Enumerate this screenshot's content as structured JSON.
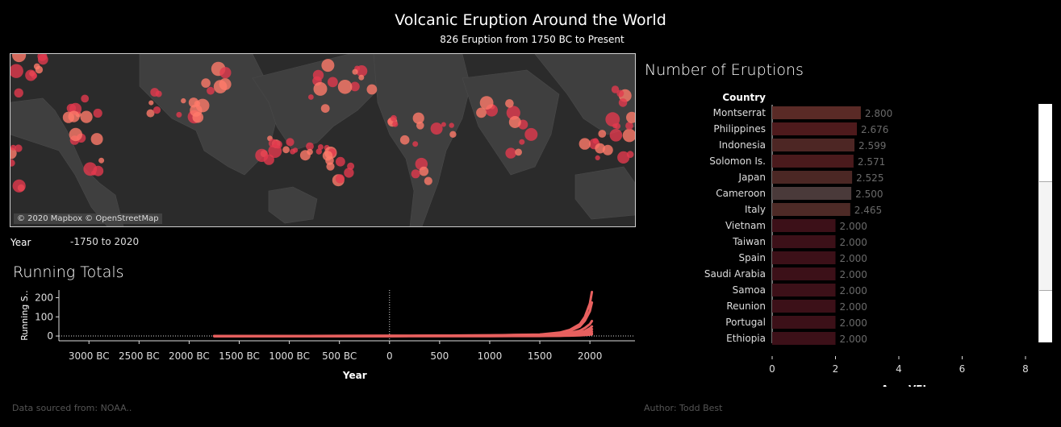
{
  "header": {
    "title": "Volcanic Eruption Around the World",
    "subtitle": "826 Eruption from 1750 BC to Present"
  },
  "map": {
    "credit": "© 2020 Mapbox © OpenStreetMap",
    "colors": {
      "water": "#2b2b2b",
      "land": "#3f3f3f",
      "dot": "#ff6b6b"
    }
  },
  "filter": {
    "label": "Year",
    "value": "-1750 to 2020"
  },
  "running_totals": {
    "title": "Running Totals"
  },
  "bar_section": {
    "title": "Number of Eruptions"
  },
  "footer": {
    "source": "Data sourced from: NOAA..",
    "author": "Author: Todd Best"
  },
  "chart_data": [
    {
      "type": "line",
      "title": "Running Totals",
      "xlabel": "Year",
      "ylabel": "Running S..",
      "x_ticks": [
        "3000 BC",
        "2500 BC",
        "2000 BC",
        "1500 BC",
        "1000 BC",
        "500 BC",
        "0",
        "500",
        "1000",
        "1500",
        "2000"
      ],
      "x_tick_values": [
        -3000,
        -2500,
        -2000,
        -1500,
        -1000,
        -500,
        0,
        500,
        1000,
        1500,
        2000
      ],
      "y_ticks": [
        0,
        100,
        200
      ],
      "xlim": [
        -3300,
        2450
      ],
      "ylim": [
        -25,
        240
      ],
      "color": "#e8605f",
      "series": [
        {
          "x": [
            -1750,
            0,
            1000,
            1500,
            1700,
            1800,
            1900,
            1950,
            2000,
            2020
          ],
          "y": [
            0,
            1,
            3,
            8,
            18,
            32,
            62,
            100,
            170,
            230
          ]
        },
        {
          "x": [
            -1750,
            0,
            1000,
            1500,
            1700,
            1800,
            1900,
            1950,
            2000,
            2020
          ],
          "y": [
            0,
            1,
            3,
            7,
            14,
            26,
            50,
            80,
            130,
            175
          ]
        },
        {
          "x": [
            -1750,
            0,
            1000,
            1500,
            1700,
            1800,
            1900,
            1950,
            2000,
            2020
          ],
          "y": [
            0,
            0,
            2,
            5,
            9,
            16,
            28,
            42,
            62,
            78
          ]
        },
        {
          "x": [
            -1750,
            0,
            1000,
            1500,
            1700,
            1800,
            1900,
            1950,
            2000,
            2020
          ],
          "y": [
            0,
            0,
            1,
            3,
            6,
            10,
            18,
            26,
            40,
            50
          ]
        },
        {
          "x": [
            -1750,
            0,
            1000,
            1500,
            1700,
            1800,
            1900,
            1950,
            2000,
            2020
          ],
          "y": [
            0,
            0,
            1,
            2,
            4,
            7,
            12,
            18,
            28,
            36
          ]
        },
        {
          "x": [
            -1750,
            0,
            1000,
            1500,
            1700,
            1800,
            1900,
            1950,
            2000,
            2020
          ],
          "y": [
            0,
            0,
            0,
            1,
            2,
            4,
            8,
            12,
            18,
            24
          ]
        },
        {
          "x": [
            -1750,
            0,
            1000,
            1500,
            1700,
            1800,
            1900,
            1950,
            2000,
            2020
          ],
          "y": [
            0,
            0,
            0,
            1,
            1,
            3,
            5,
            8,
            12,
            15
          ]
        },
        {
          "x": [
            -1750,
            0,
            1000,
            1500,
            1700,
            1800,
            1900,
            1950,
            2000,
            2020
          ],
          "y": [
            0,
            0,
            0,
            0,
            1,
            2,
            3,
            5,
            7,
            9
          ]
        }
      ]
    },
    {
      "type": "bar",
      "orientation": "horizontal",
      "title": "Number of Eruptions",
      "category_header": "Country",
      "xlabel": "Avg. VEI",
      "xlim": [
        0,
        8
      ],
      "x_ticks": [
        0,
        2,
        4,
        6,
        8
      ],
      "categories": [
        "Montserrat",
        "Philippines",
        "Indonesia",
        "Solomon Is.",
        "Japan",
        "Cameroon",
        "Italy",
        "Vietnam",
        "Taiwan",
        "Spain",
        "Saudi Arabia",
        "Samoa",
        "Reunion",
        "Portugal",
        "Ethiopia"
      ],
      "values": [
        2.8,
        2.676,
        2.599,
        2.571,
        2.525,
        2.5,
        2.465,
        2.0,
        2.0,
        2.0,
        2.0,
        2.0,
        2.0,
        2.0,
        2.0
      ],
      "labels": [
        "2.800",
        "2.676",
        "2.599",
        "2.571",
        "2.525",
        "2.500",
        "2.465",
        "2.000",
        "2.000",
        "2.000",
        "2.000",
        "2.000",
        "2.000",
        "2.000",
        "2.000"
      ],
      "colors": [
        "#5a2a26",
        "#4e1a1c",
        "#4d2624",
        "#4a1a1c",
        "#4b2724",
        "#4a3a3a",
        "#4d2a26",
        "#3c1018",
        "#3c1018",
        "#3c1018",
        "#3c1018",
        "#3c1018",
        "#3c1018",
        "#3c1018",
        "#3c1018"
      ]
    }
  ]
}
